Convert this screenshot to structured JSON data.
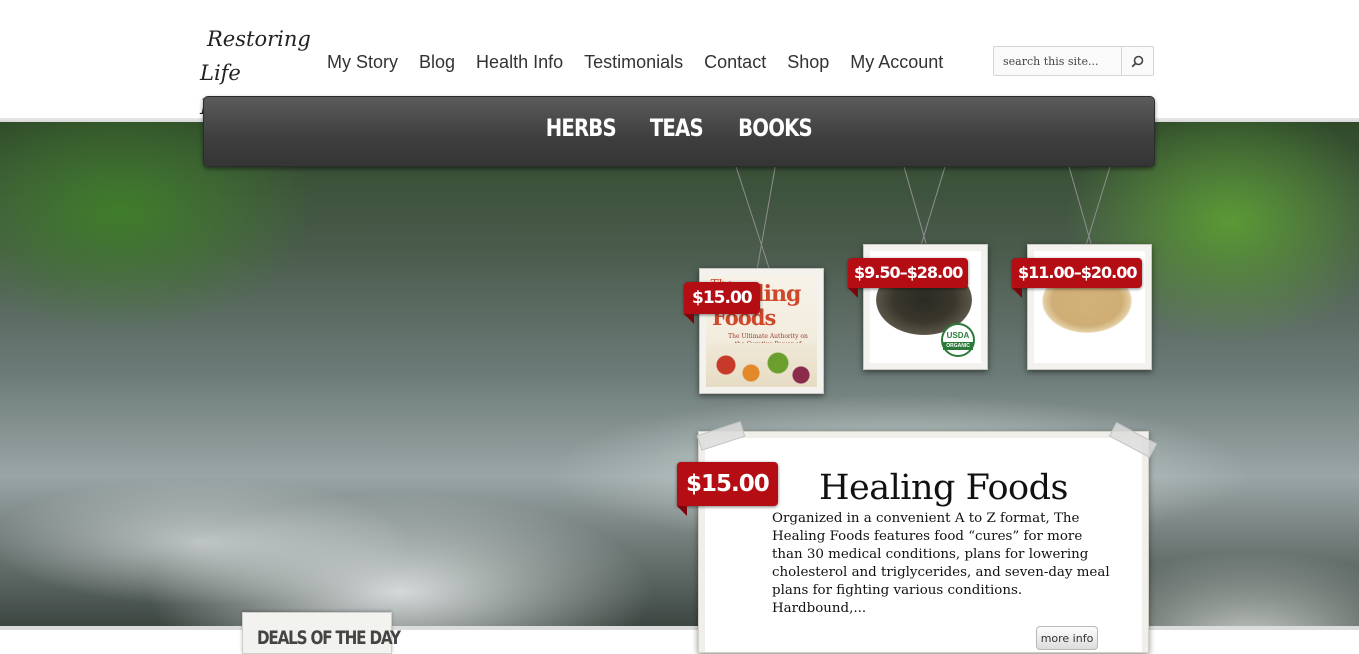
{
  "site": {
    "logo_line1": "Restoring",
    "logo_line2": "Life Herbs"
  },
  "nav": {
    "items": [
      "My Story",
      "Blog",
      "Health Info",
      "Testimonials",
      "Contact",
      "Shop",
      "My Account"
    ]
  },
  "search": {
    "placeholder": "search this site...",
    "icon": "search-icon"
  },
  "categories": [
    "HERBS",
    "TEAS",
    "BOOKS"
  ],
  "products": [
    {
      "price": "$15.00",
      "cover_line1": "The",
      "cover_line2": "ealing",
      "cover_line3": "Foods",
      "cover_sub": "The Ultimate Authority on the Curative Power of Nutrition"
    },
    {
      "price": "$9.50–$28.00",
      "badge_top": "USDA",
      "badge_bottom": "ORGANIC"
    },
    {
      "price": "$11.00–$20.00"
    }
  ],
  "featured": {
    "price": "$15.00",
    "title": "Healing Foods",
    "description": "Organized in a convenient A to Z format, The Healing Foods features food “cures” for more than 30 medical conditions, plans for lowering cholesterol and triglycerides, and seven-day meal plans for fighting various conditions. Hardbound,...",
    "more_label": "more info"
  },
  "deals": {
    "label": "DEALS OF THE DAY"
  },
  "colors": {
    "price_tag": "#b40d14",
    "category_bar": "#3e3e3e"
  }
}
